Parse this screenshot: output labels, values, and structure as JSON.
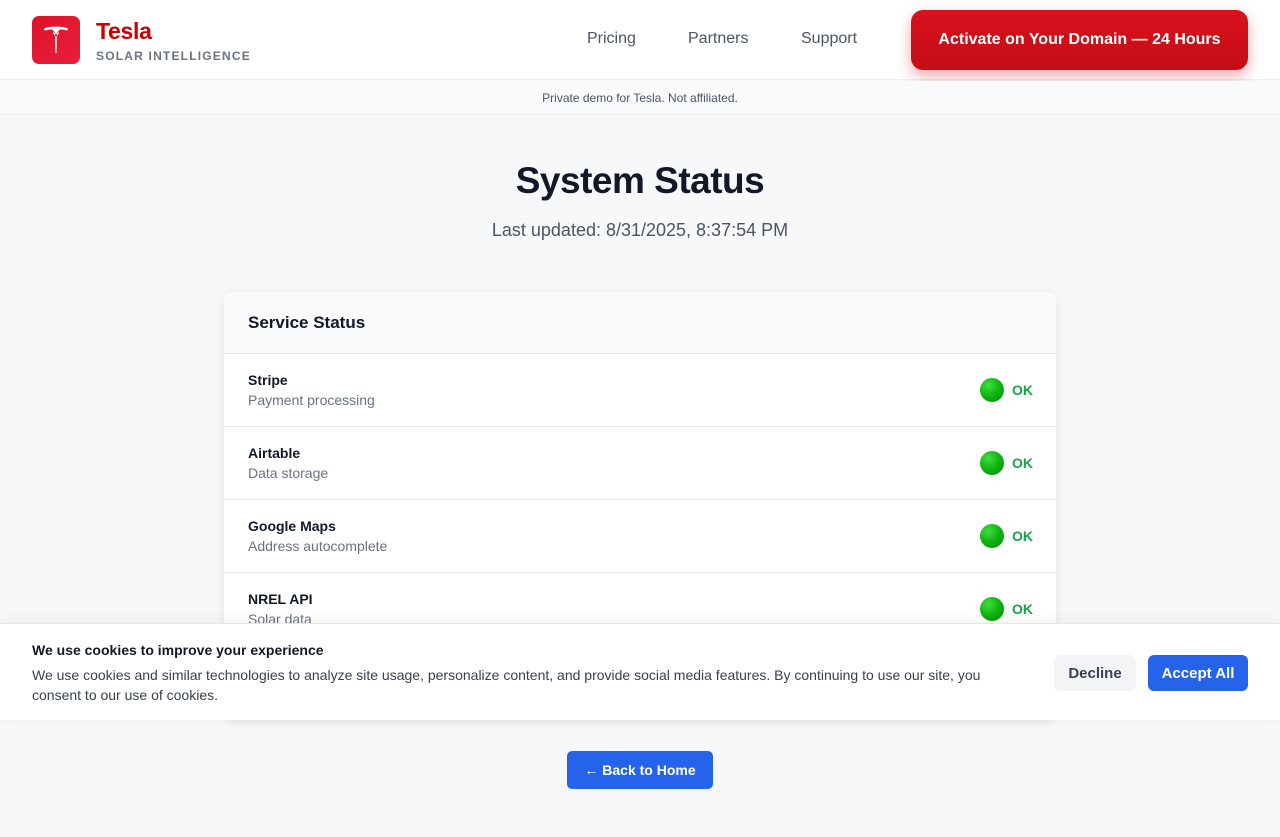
{
  "header": {
    "brand_name": "Tesla",
    "brand_sub": "SOLAR INTELLIGENCE",
    "logo_icon": "tesla-t-logo",
    "nav": [
      {
        "label": "Pricing"
      },
      {
        "label": "Partners"
      },
      {
        "label": "Support"
      }
    ],
    "cta_label": "Activate on Your Domain — 24 Hours"
  },
  "disclaimer": "Private demo for Tesla. Not affiliated.",
  "main": {
    "title": "System Status",
    "last_updated": "Last updated: 8/31/2025, 8:37:54 PM"
  },
  "card": {
    "title": "Service Status",
    "services": [
      {
        "name": "Stripe",
        "desc": "Payment processing",
        "status": "OK"
      },
      {
        "name": "Airtable",
        "desc": "Data storage",
        "status": "OK"
      },
      {
        "name": "Google Maps",
        "desc": "Address autocomplete",
        "status": "OK"
      },
      {
        "name": "NREL API",
        "desc": "Solar data",
        "status": "OK"
      }
    ]
  },
  "cookie": {
    "title": "We use cookies to improve your experience",
    "body": "We use cookies and similar technologies to analyze site usage, personalize content, and provide social media features. By continuing to use our site, you consent to our use of cookies.",
    "decline_label": "Decline",
    "accept_label": "Accept All"
  },
  "back_label": "← Back to Home",
  "colors": {
    "brand_red": "#cc0000",
    "accent_blue": "#2563eb",
    "status_ok": "#16a34a"
  }
}
